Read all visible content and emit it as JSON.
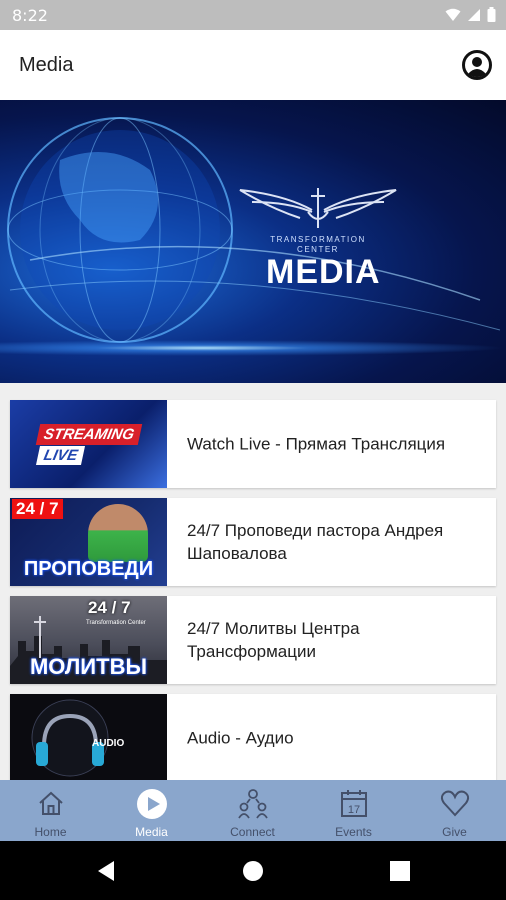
{
  "status_bar": {
    "time": "8:22"
  },
  "app_bar": {
    "title": "Media"
  },
  "hero": {
    "logo_text": "TRANSFORMATION\nCENTER",
    "title": "MEDIA"
  },
  "media_items": [
    {
      "label": "Watch Live - Прямая Трансляция",
      "thumb_text": [
        "STREAMING",
        "LIVE"
      ]
    },
    {
      "label": "24/7 Проповеди пастора Андрея Шаповалова",
      "thumb_text": [
        "24 / 7",
        "ПРОПОВЕДИ"
      ]
    },
    {
      "label": "24/7 Молитвы Центра Трансформации",
      "thumb_text": [
        "24 / 7",
        "Transformation Center",
        "МОЛИТВЫ"
      ]
    },
    {
      "label": "Audio - Аудио",
      "thumb_text": [
        "AUDIO"
      ]
    }
  ],
  "tabs": [
    {
      "label": "Home",
      "icon": "home-icon",
      "active": false
    },
    {
      "label": "Media",
      "icon": "play-icon",
      "active": true
    },
    {
      "label": "Connect",
      "icon": "connect-icon",
      "active": false
    },
    {
      "label": "Events",
      "icon": "calendar-icon",
      "active": false,
      "badge": "17"
    },
    {
      "label": "Give",
      "icon": "heart-icon",
      "active": false
    }
  ],
  "colors": {
    "tabbar_bg": "#8aa6cc",
    "tab_active": "#ffffff",
    "tab_inactive": "#44506a",
    "status_bar_bg": "#bdbdbd"
  }
}
